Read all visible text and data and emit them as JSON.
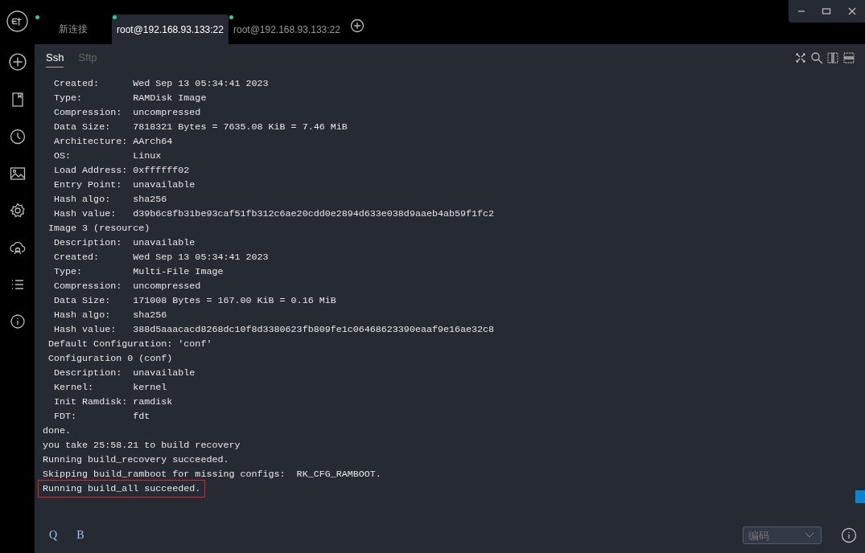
{
  "tabs": [
    {
      "label": "新连接",
      "selected": false
    },
    {
      "label": "root@192.168.93.133:22",
      "selected": true
    },
    {
      "label": "root@192.168.93.133:22",
      "selected": false
    }
  ],
  "subtabs": [
    {
      "label": "Ssh",
      "selected": true
    },
    {
      "label": "Sftp",
      "selected": false
    }
  ],
  "terminal": {
    "lines": [
      {
        "text": "  Created:      Wed Sep 13 05:34:41 2023",
        "highlighted": false
      },
      {
        "text": "  Type:         RAMDisk Image",
        "highlighted": false
      },
      {
        "text": "  Compression:  uncompressed",
        "highlighted": false
      },
      {
        "text": "  Data Size:    7818321 Bytes = 7635.08 KiB = 7.46 MiB",
        "highlighted": false
      },
      {
        "text": "  Architecture: AArch64",
        "highlighted": false
      },
      {
        "text": "  OS:           Linux",
        "highlighted": false
      },
      {
        "text": "  Load Address: 0xffffff02",
        "highlighted": false
      },
      {
        "text": "  Entry Point:  unavailable",
        "highlighted": false
      },
      {
        "text": "  Hash algo:    sha256",
        "highlighted": false
      },
      {
        "text": "  Hash value:   d39b6c8fb31be93caf51fb312c6ae20cdd0e2894d633e038d9aaeb4ab59f1fc2",
        "highlighted": false
      },
      {
        "text": " Image 3 (resource)",
        "highlighted": false
      },
      {
        "text": "  Description:  unavailable",
        "highlighted": false
      },
      {
        "text": "  Created:      Wed Sep 13 05:34:41 2023",
        "highlighted": false
      },
      {
        "text": "  Type:         Multi-File Image",
        "highlighted": false
      },
      {
        "text": "  Compression:  uncompressed",
        "highlighted": false
      },
      {
        "text": "  Data Size:    171008 Bytes = 167.00 KiB = 0.16 MiB",
        "highlighted": false
      },
      {
        "text": "  Hash algo:    sha256",
        "highlighted": false
      },
      {
        "text": "  Hash value:   388d5aaacacd8268dc10f8d3380623fb809fe1c06468623390eaaf9e16ae32c8",
        "highlighted": false
      },
      {
        "text": " Default Configuration: 'conf'",
        "highlighted": false
      },
      {
        "text": " Configuration 0 (conf)",
        "highlighted": false
      },
      {
        "text": "  Description:  unavailable",
        "highlighted": false
      },
      {
        "text": "  Kernel:       kernel",
        "highlighted": false
      },
      {
        "text": "  Init Ramdisk: ramdisk",
        "highlighted": false
      },
      {
        "text": "  FDT:          fdt",
        "highlighted": false
      },
      {
        "text": "done.",
        "highlighted": false
      },
      {
        "text": "you take 25:58.21 to build recovery",
        "highlighted": false
      },
      {
        "text": "Running build_recovery succeeded.",
        "highlighted": false
      },
      {
        "text": "Skipping build_ramboot for missing configs:  RK_CFG_RAMBOOT.",
        "highlighted": false
      },
      {
        "text": "Running build_all succeeded.",
        "highlighted": true
      }
    ]
  },
  "bottom_bar": {
    "buttons": [
      "Q",
      "B"
    ],
    "encoding": {
      "placeholder": "编码"
    }
  }
}
